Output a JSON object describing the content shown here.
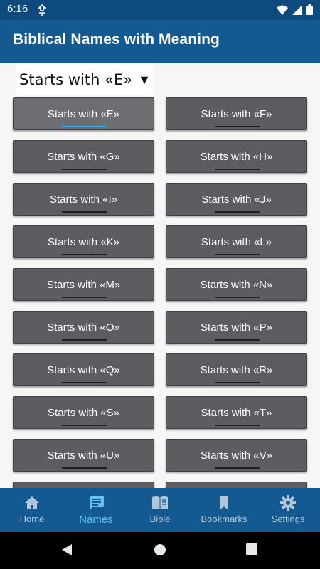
{
  "status_bar": {
    "time": "6:16"
  },
  "app_bar": {
    "title": "Biblical Names with Meaning"
  },
  "spinner": {
    "selected": "Starts with «E»",
    "arrow": "▼"
  },
  "letter_buttons": [
    "Starts with «E»",
    "Starts with «F»",
    "Starts with «G»",
    "Starts with «H»",
    "Starts with «I»",
    "Starts with «J»",
    "Starts with «K»",
    "Starts with «L»",
    "Starts with «M»",
    "Starts with «N»",
    "Starts with «O»",
    "Starts with «P»",
    "Starts with «Q»",
    "Starts with «R»",
    "Starts with «S»",
    "Starts with «T»",
    "Starts with «U»",
    "Starts with «V»"
  ],
  "bottom_nav": [
    {
      "label": "Home",
      "icon": "home-icon"
    },
    {
      "label": "Names",
      "icon": "names-icon",
      "active": true
    },
    {
      "label": "Bible",
      "icon": "bible-icon"
    },
    {
      "label": "Bookmarks",
      "icon": "bookmark-icon"
    },
    {
      "label": "Settings",
      "icon": "settings-icon"
    }
  ],
  "colors": {
    "app_bar": "#135a93",
    "status_bar": "#0d4a7e",
    "button": "#5b5d61",
    "active_accent": "#3aa3ee",
    "nav_active": "#66bff6"
  }
}
